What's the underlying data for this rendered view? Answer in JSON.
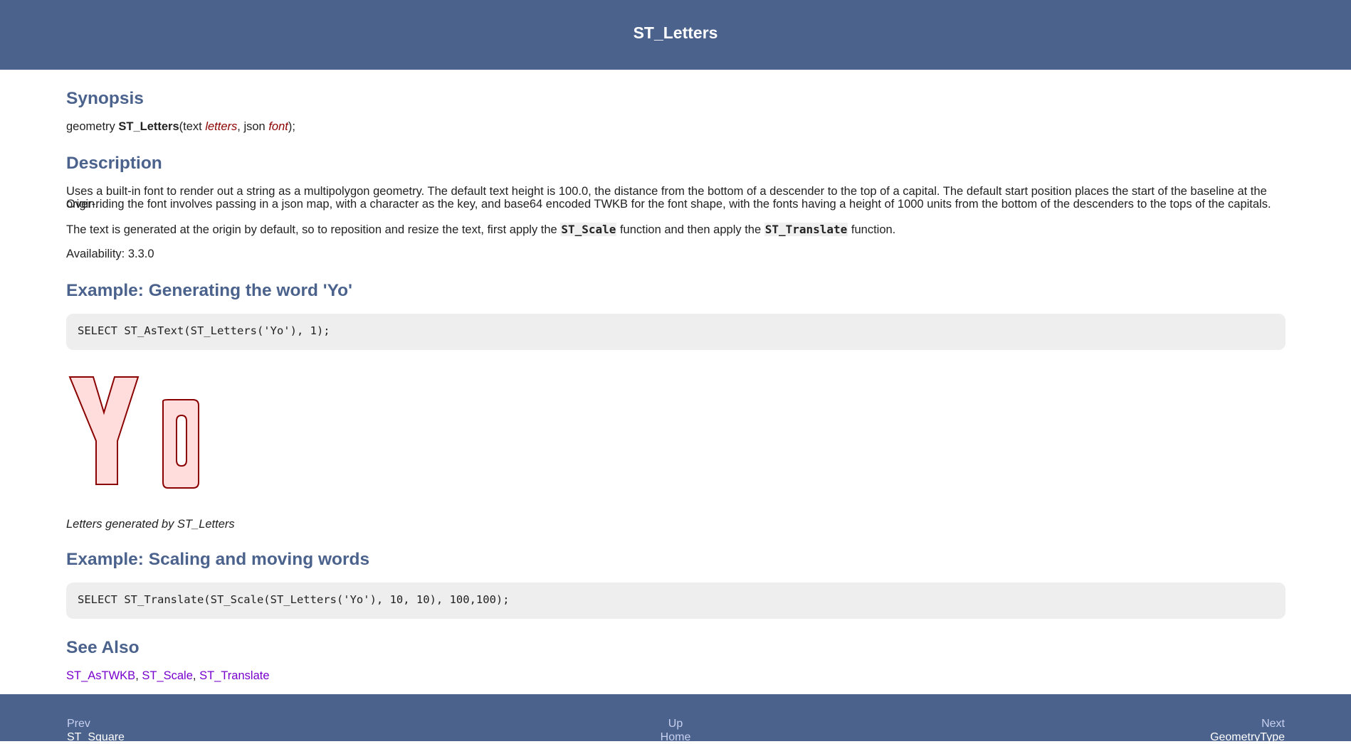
{
  "header": {
    "title": "ST_Letters"
  },
  "synopsis": {
    "heading": "Synopsis",
    "return_type": "geometry",
    "function_name": "ST_Letters",
    "open": "(text ",
    "param1": "letters",
    "sep": ", json ",
    "param2": "font",
    "close": ");"
  },
  "description": {
    "heading": "Description",
    "paragraph1_line1": "Uses a built-in font to render out a string as a multipolygon geometry. The default text height is 100.0, the distance from the bottom of a descender to the top of a capital. The default start position places the start of the baseline at the origin.",
    "paragraph1_line2": "Over-riding the font involves passing in a json map, with a character as the key, and base64 encoded TWKB for the font shape, with the fonts having a height of 1000 units from the bottom of the descenders to the tops of the capitals.",
    "paragraph2_a": "The text is generated at the origin by default, so to reposition and resize the text, first apply the ",
    "paragraph2_code1": "ST_Scale",
    "paragraph2_b": " function and then apply the ",
    "paragraph2_code2": "ST_Translate",
    "paragraph2_c": " function.",
    "availability": "Availability: 3.3.0"
  },
  "example1": {
    "heading": "Example: Generating the word 'Yo'",
    "code": "SELECT ST_AsText(ST_Letters('Yo'), 1);",
    "caption": "Letters generated by ST_Letters",
    "glyph_fill": "#ffdddd",
    "glyph_stroke": "#8b0000"
  },
  "example2": {
    "heading": "Example: Scaling and moving words",
    "code": "SELECT ST_Translate(ST_Scale(ST_Letters('Yo'), 10, 10), 100,100);"
  },
  "see_also": {
    "heading": "See Also",
    "links": [
      "ST_AsTWKB",
      "ST_Scale",
      "ST_Translate"
    ],
    "separator": ", "
  },
  "footer": {
    "prev_label": "Prev",
    "prev_target": "ST_Square",
    "up_label": "Up",
    "home_label": "Home",
    "next_label": "Next",
    "next_target": "GeometryType"
  },
  "colors": {
    "header_bg": "#4a628c",
    "heading": "#4a628c",
    "link": "#7700cc",
    "param": "#8b0000",
    "code_bg": "#eeeeee"
  }
}
